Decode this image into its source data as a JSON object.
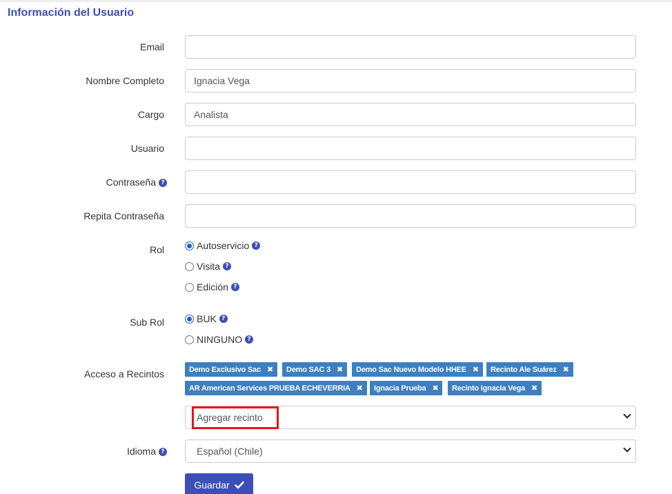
{
  "section_title": "Información del Usuario",
  "fields": {
    "email": {
      "label": "Email",
      "value": ""
    },
    "full_name": {
      "label": "Nombre Completo",
      "value": "Ignacia Vega"
    },
    "position": {
      "label": "Cargo",
      "value": "Analista"
    },
    "username": {
      "label": "Usuario",
      "value": ""
    },
    "password": {
      "label": "Contraseña",
      "value": ""
    },
    "password_repeat": {
      "label": "Repita Contraseña",
      "value": ""
    }
  },
  "role": {
    "label": "Rol",
    "options": [
      {
        "label": "Autoservicio",
        "checked": true
      },
      {
        "label": "Visita",
        "checked": false
      },
      {
        "label": "Edición",
        "checked": false
      }
    ]
  },
  "sub_role": {
    "label": "Sub Rol",
    "options": [
      {
        "label": "BUK",
        "checked": true
      },
      {
        "label": "NINGUNO",
        "checked": false
      }
    ]
  },
  "venues": {
    "label": "Acceso a Recintos",
    "tags": [
      "Demo Exclusivo Sac",
      "Demo SAC 3",
      "Demo Sac Nuevo Modelo HHEE",
      "Recinto Ale Suárez",
      "AR American Services PRUEBA ECHEVERRIA",
      "Ignacia Prueba",
      "Recinto Ignacia Vega"
    ],
    "add_select_value": "Agregar recinto"
  },
  "language": {
    "label": "Idioma",
    "value": "Español (Chile)"
  },
  "save_button": "Guardar",
  "help_glyph": "?",
  "remove_glyph": "✖",
  "colors": {
    "accent": "#3c4eb8",
    "tag": "#3d7fc1",
    "highlight": "#e8141b"
  }
}
